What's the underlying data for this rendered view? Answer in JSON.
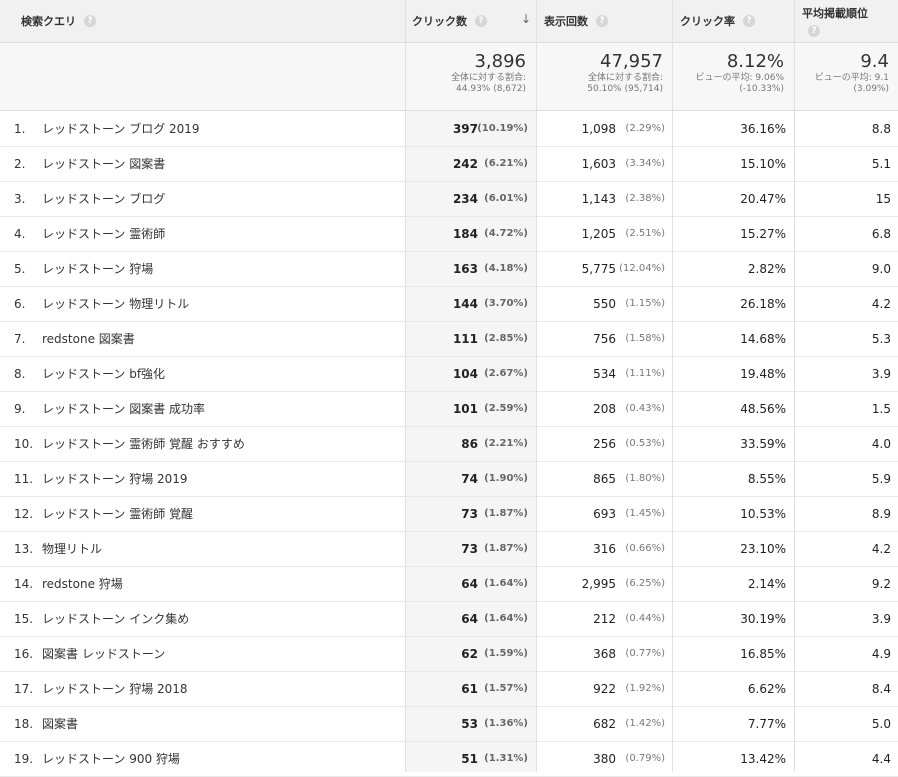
{
  "headers": {
    "query": "検索クエリ",
    "clicks": "クリック数",
    "impressions": "表示回数",
    "ctr": "クリック率",
    "position": "平均掲載順位",
    "help": "?",
    "sort_arrow": "↓"
  },
  "totals": {
    "clicks": {
      "value": "3,896",
      "line1": "全体に対する割合:",
      "line2": "44.93% (8,672)"
    },
    "impressions": {
      "value": "47,957",
      "line1": "全体に対する割合:",
      "line2": "50.10% (95,714)"
    },
    "ctr": {
      "value": "8.12%",
      "line1": "ビューの平均: 9.06%",
      "line2": "(-10.33%)"
    },
    "position": {
      "value": "9.4",
      "line1": "ビューの平均: 9.1",
      "line2": "(3.09%)"
    }
  },
  "rows": [
    {
      "idx": "1.",
      "query": "レッドストーン ブログ 2019",
      "clicks": "397",
      "clicks_pct": "(10.19%)",
      "impr": "1,098",
      "impr_pct": "(2.29%)",
      "ctr": "36.16%",
      "pos": "8.8"
    },
    {
      "idx": "2.",
      "query": "レッドストーン 図案書",
      "clicks": "242",
      "clicks_pct": "(6.21%)",
      "impr": "1,603",
      "impr_pct": "(3.34%)",
      "ctr": "15.10%",
      "pos": "5.1"
    },
    {
      "idx": "3.",
      "query": "レッドストーン ブログ",
      "clicks": "234",
      "clicks_pct": "(6.01%)",
      "impr": "1,143",
      "impr_pct": "(2.38%)",
      "ctr": "20.47%",
      "pos": "15"
    },
    {
      "idx": "4.",
      "query": "レッドストーン 霊術師",
      "clicks": "184",
      "clicks_pct": "(4.72%)",
      "impr": "1,205",
      "impr_pct": "(2.51%)",
      "ctr": "15.27%",
      "pos": "6.8"
    },
    {
      "idx": "5.",
      "query": "レッドストーン 狩場",
      "clicks": "163",
      "clicks_pct": "(4.18%)",
      "impr": "5,775",
      "impr_pct": "(12.04%)",
      "ctr": "2.82%",
      "pos": "9.0"
    },
    {
      "idx": "6.",
      "query": "レッドストーン 物理リトル",
      "clicks": "144",
      "clicks_pct": "(3.70%)",
      "impr": "550",
      "impr_pct": "(1.15%)",
      "ctr": "26.18%",
      "pos": "4.2"
    },
    {
      "idx": "7.",
      "query": "redstone 図案書",
      "clicks": "111",
      "clicks_pct": "(2.85%)",
      "impr": "756",
      "impr_pct": "(1.58%)",
      "ctr": "14.68%",
      "pos": "5.3"
    },
    {
      "idx": "8.",
      "query": "レッドストーン bf強化",
      "clicks": "104",
      "clicks_pct": "(2.67%)",
      "impr": "534",
      "impr_pct": "(1.11%)",
      "ctr": "19.48%",
      "pos": "3.9"
    },
    {
      "idx": "9.",
      "query": "レッドストーン 図案書 成功率",
      "clicks": "101",
      "clicks_pct": "(2.59%)",
      "impr": "208",
      "impr_pct": "(0.43%)",
      "ctr": "48.56%",
      "pos": "1.5"
    },
    {
      "idx": "10.",
      "query": "レッドストーン 霊術師 覚醒 おすすめ",
      "clicks": "86",
      "clicks_pct": "(2.21%)",
      "impr": "256",
      "impr_pct": "(0.53%)",
      "ctr": "33.59%",
      "pos": "4.0"
    },
    {
      "idx": "11.",
      "query": "レッドストーン 狩場 2019",
      "clicks": "74",
      "clicks_pct": "(1.90%)",
      "impr": "865",
      "impr_pct": "(1.80%)",
      "ctr": "8.55%",
      "pos": "5.9"
    },
    {
      "idx": "12.",
      "query": "レッドストーン 霊術師 覚醒",
      "clicks": "73",
      "clicks_pct": "(1.87%)",
      "impr": "693",
      "impr_pct": "(1.45%)",
      "ctr": "10.53%",
      "pos": "8.9"
    },
    {
      "idx": "13.",
      "query": "物理リトル",
      "clicks": "73",
      "clicks_pct": "(1.87%)",
      "impr": "316",
      "impr_pct": "(0.66%)",
      "ctr": "23.10%",
      "pos": "4.2"
    },
    {
      "idx": "14.",
      "query": "redstone 狩場",
      "clicks": "64",
      "clicks_pct": "(1.64%)",
      "impr": "2,995",
      "impr_pct": "(6.25%)",
      "ctr": "2.14%",
      "pos": "9.2"
    },
    {
      "idx": "15.",
      "query": "レッドストーン インク集め",
      "clicks": "64",
      "clicks_pct": "(1.64%)",
      "impr": "212",
      "impr_pct": "(0.44%)",
      "ctr": "30.19%",
      "pos": "3.9"
    },
    {
      "idx": "16.",
      "query": "図案書 レッドストーン",
      "clicks": "62",
      "clicks_pct": "(1.59%)",
      "impr": "368",
      "impr_pct": "(0.77%)",
      "ctr": "16.85%",
      "pos": "4.9"
    },
    {
      "idx": "17.",
      "query": "レッドストーン 狩場 2018",
      "clicks": "61",
      "clicks_pct": "(1.57%)",
      "impr": "922",
      "impr_pct": "(1.92%)",
      "ctr": "6.62%",
      "pos": "8.4"
    },
    {
      "idx": "18.",
      "query": "図案書",
      "clicks": "53",
      "clicks_pct": "(1.36%)",
      "impr": "682",
      "impr_pct": "(1.42%)",
      "ctr": "7.77%",
      "pos": "5.0"
    },
    {
      "idx": "19.",
      "query": "レッドストーン 900 狩場",
      "clicks": "51",
      "clicks_pct": "(1.31%)",
      "impr": "380",
      "impr_pct": "(0.79%)",
      "ctr": "13.42%",
      "pos": "4.4"
    }
  ]
}
